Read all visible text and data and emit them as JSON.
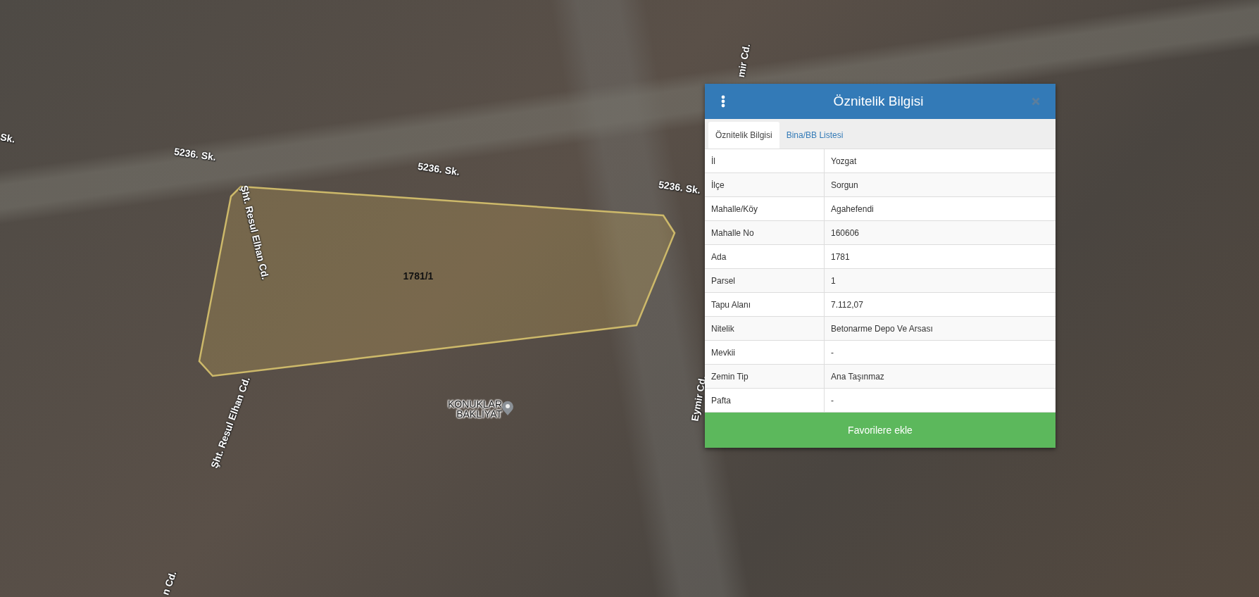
{
  "map": {
    "labels": [
      {
        "kind": "street",
        "text": "Sk."
      },
      {
        "kind": "street",
        "text": "5236. Sk."
      },
      {
        "kind": "street",
        "text": "5236. Sk."
      },
      {
        "kind": "street",
        "text": "5236. Sk."
      },
      {
        "kind": "street",
        "text": "Şht. Resul Elhan Cd."
      },
      {
        "kind": "parcel",
        "text": "1781/1"
      },
      {
        "kind": "street",
        "text": "Şht. Resul Elhan Cd."
      },
      {
        "kind": "poi",
        "text": "KONUKLAR BAKLİYAT"
      },
      {
        "kind": "street",
        "text": "Eymir Cd."
      },
      {
        "kind": "street",
        "text": "mir Cd."
      },
      {
        "kind": "street",
        "text": "n Cd."
      }
    ]
  },
  "panel": {
    "title": "Öznitelik Bilgisi",
    "tabs": [
      {
        "label": "Öznitelik Bilgisi",
        "selected": true
      },
      {
        "label": "Bina/BB Listesi",
        "selected": false
      }
    ],
    "rows": [
      {
        "label": "İl",
        "value": "Yozgat"
      },
      {
        "label": "İlçe",
        "value": "Sorgun"
      },
      {
        "label": "Mahalle/Köy",
        "value": "Agahefendi"
      },
      {
        "label": "Mahalle No",
        "value": "160606"
      },
      {
        "label": "Ada",
        "value": "1781"
      },
      {
        "label": "Parsel",
        "value": "1"
      },
      {
        "label": "Tapu Alanı",
        "value": "7.112,07"
      },
      {
        "label": "Nitelik",
        "value": "Betonarme Depo Ve Arsası"
      },
      {
        "label": "Mevkii",
        "value": "-"
      },
      {
        "label": "Zemin Tip",
        "value": "Ana Taşınmaz"
      },
      {
        "label": "Pafta",
        "value": "-"
      }
    ],
    "button": "Favorilere ekle"
  }
}
